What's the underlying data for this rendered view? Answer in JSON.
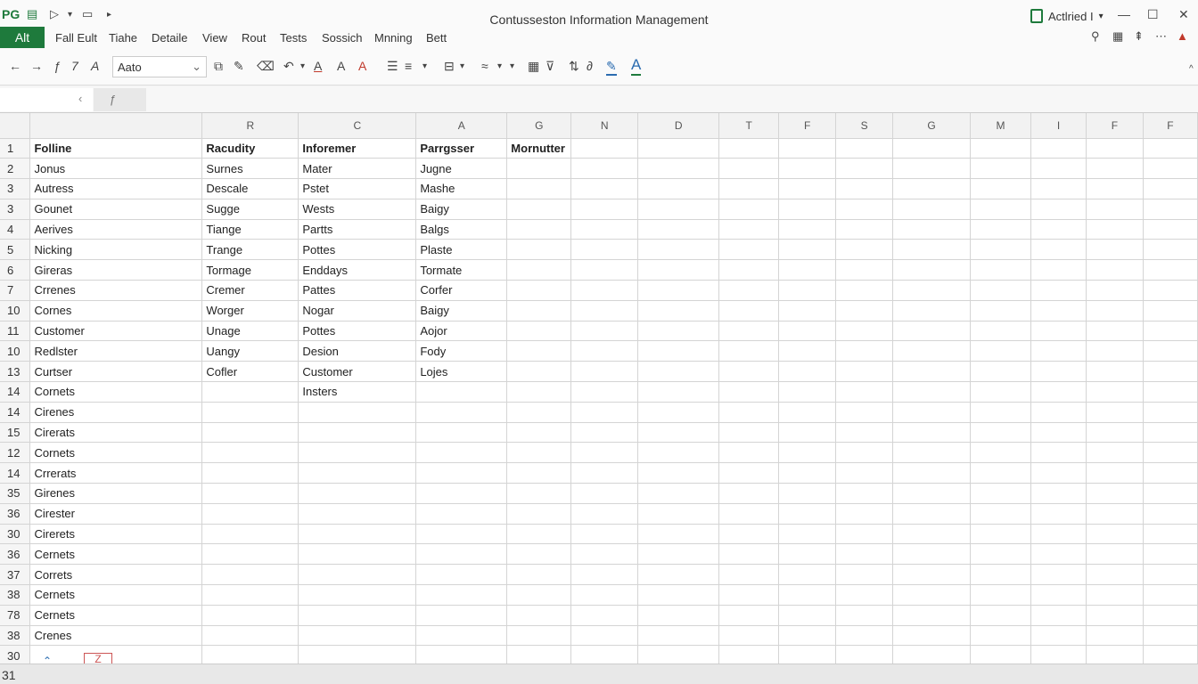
{
  "app": {
    "logo": "PG",
    "title": "Contusseston Information Management",
    "account_label": "Actlried I"
  },
  "menu": {
    "alt_label": "Alt",
    "items": [
      "Fall Eult",
      "Tiahe",
      "Detaile",
      "View",
      "Rout",
      "Tests",
      "Sossich",
      "Mnning",
      "Bett"
    ]
  },
  "toolbar": {
    "font_name": "Aato"
  },
  "columns": [
    "R",
    "C",
    "A",
    "G",
    "N",
    "D",
    "T",
    "F",
    "S",
    "G",
    "M",
    "I",
    "F",
    "F"
  ],
  "rows": [
    {
      "num": "1",
      "cells": [
        "Folline",
        "Racudity",
        "Inforemer",
        "Parrgsser",
        "Mornutter"
      ],
      "header": true
    },
    {
      "num": "2",
      "cells": [
        "Jonus",
        "Surnes",
        "Mater",
        "Jugne",
        ""
      ]
    },
    {
      "num": "3",
      "cells": [
        "Autress",
        "Descale",
        "Pstet",
        "Mashe",
        ""
      ]
    },
    {
      "num": "3",
      "cells": [
        "Gounet",
        "Sugge",
        "Wests",
        "Baigy",
        ""
      ]
    },
    {
      "num": "4",
      "cells": [
        "Aerives",
        "Tiange",
        "Partts",
        "Balgs",
        ""
      ]
    },
    {
      "num": "5",
      "cells": [
        "Nicking",
        "Trange",
        "Pottes",
        "Plaste",
        ""
      ]
    },
    {
      "num": "6",
      "cells": [
        "Gireras",
        "Tormage",
        "Enddays",
        "Tormate",
        ""
      ]
    },
    {
      "num": "7",
      "cells": [
        "Crrenes",
        "Cremer",
        "Pattes",
        "Corfer",
        ""
      ]
    },
    {
      "num": "10",
      "cells": [
        "Cornes",
        "Worger",
        "Nogar",
        "Baigy",
        ""
      ]
    },
    {
      "num": "11",
      "cells": [
        "Customer",
        "Unage",
        "Pottes",
        "Aojor",
        ""
      ]
    },
    {
      "num": "10",
      "cells": [
        "Redlster",
        "Uangy",
        "Desion",
        "Fody",
        ""
      ]
    },
    {
      "num": "13",
      "cells": [
        "Curtser",
        "Cofler",
        "Customer",
        "Lojes",
        ""
      ]
    },
    {
      "num": "14",
      "cells": [
        "Cornets",
        "",
        "Insters",
        "",
        ""
      ]
    },
    {
      "num": "14",
      "cells": [
        "Cirenes",
        "",
        "",
        "",
        ""
      ]
    },
    {
      "num": "15",
      "cells": [
        "Cirerats",
        "",
        "",
        "",
        ""
      ]
    },
    {
      "num": "12",
      "cells": [
        "Cornets",
        "",
        "",
        "",
        ""
      ]
    },
    {
      "num": "14",
      "cells": [
        "Crrerats",
        "",
        "",
        "",
        ""
      ]
    },
    {
      "num": "35",
      "cells": [
        "Girenes",
        "",
        "",
        "",
        ""
      ]
    },
    {
      "num": "36",
      "cells": [
        "Cirester",
        "",
        "",
        "",
        ""
      ]
    },
    {
      "num": "30",
      "cells": [
        "Cirerets",
        "",
        "",
        "",
        ""
      ]
    },
    {
      "num": "36",
      "cells": [
        "Cernets",
        "",
        "",
        "",
        ""
      ]
    },
    {
      "num": "37",
      "cells": [
        "Correts",
        "",
        "",
        "",
        ""
      ]
    },
    {
      "num": "38",
      "cells": [
        "Cernets",
        "",
        "",
        "",
        ""
      ]
    },
    {
      "num": "78",
      "cells": [
        "Cernets",
        "",
        "",
        "",
        ""
      ]
    },
    {
      "num": "38",
      "cells": [
        "Crenes",
        "",
        "",
        "",
        ""
      ]
    },
    {
      "num": "30",
      "cells": [
        "",
        "",
        "",
        "",
        ""
      ]
    }
  ],
  "status": {
    "row_indicator": "31"
  },
  "icons": [
    "save-icon",
    "pen-icon",
    "new-file-icon",
    "undo-icon",
    "redo-icon",
    "bold-icon",
    "italic-icon",
    "font-color-icon",
    "fill-color-icon",
    "align-icon",
    "list-icon",
    "border-icon",
    "chart-icon"
  ],
  "colors": {
    "brand": "#1e7a3c",
    "accent_blue": "#2b6cb0",
    "accent_red": "#c0392b"
  }
}
